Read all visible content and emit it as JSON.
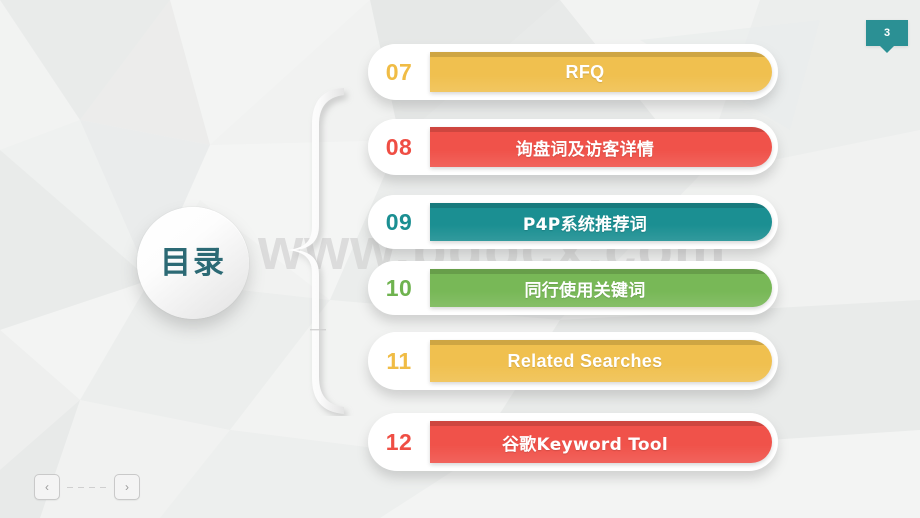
{
  "slide": {
    "page_number": "3",
    "circle_label": "目录",
    "watermark": "www.bdocx.com",
    "background_color": "#eeefef",
    "accent_teal": "#2b9094"
  },
  "colors": {
    "yellow": "#f0c04f",
    "red": "#f0524a",
    "teal": "#1b8f92",
    "green": "#78b857",
    "number_yellow": "#f0bc45",
    "number_red": "#ef4e44",
    "number_teal": "#1b8f92",
    "number_green": "#6fb34f",
    "circle_text": "#2c6a75"
  },
  "toc": {
    "items": [
      {
        "number": "07",
        "label": "RFQ",
        "color": "#f0c04f",
        "num_color": "#f0bc45",
        "script": "latin"
      },
      {
        "number": "08",
        "label": "询盘词及访客详情",
        "color": "#f0524a",
        "num_color": "#ef4e44",
        "script": "cjk"
      },
      {
        "number": "09",
        "label": "P4P系统推荐词",
        "color": "#1b8f92",
        "num_color": "#1b8f92",
        "script": "cjk"
      },
      {
        "number": "10",
        "label": "同行使用关键词",
        "color": "#78b857",
        "num_color": "#6fb34f",
        "script": "cjk"
      },
      {
        "number": "11",
        "label": "Related Searches",
        "color": "#f0c04f",
        "num_color": "#f0bc45",
        "script": "latin"
      },
      {
        "number": "12",
        "label": "谷歌Keyword Tool",
        "color": "#f0524a",
        "num_color": "#ef4e44",
        "script": "cjk"
      }
    ]
  },
  "nav": {
    "prev_glyph": "‹",
    "next_glyph": "›"
  }
}
